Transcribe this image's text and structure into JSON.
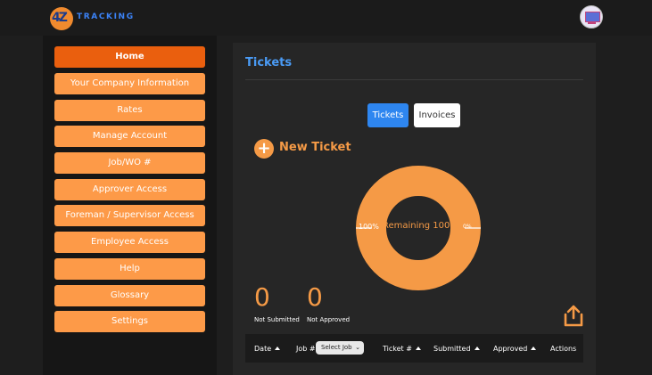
{
  "header": {
    "logo_mark": "4Z",
    "logo_text": "TRACKING"
  },
  "sidebar": {
    "items": [
      {
        "label": "Home",
        "active": true
      },
      {
        "label": "Your Company Information"
      },
      {
        "label": "Rates"
      },
      {
        "label": "Manage Account"
      },
      {
        "label": "Job/WO #"
      },
      {
        "label": "Approver Access"
      },
      {
        "label": "Foreman / Supervisor Access"
      },
      {
        "label": "Employee Access"
      },
      {
        "label": "Help"
      },
      {
        "label": "Glossary"
      },
      {
        "label": "Settings"
      }
    ]
  },
  "main": {
    "title": "Tickets",
    "tabs": [
      {
        "label": "Tickets",
        "active": true
      },
      {
        "label": "Invoices"
      }
    ],
    "new_ticket_label": "New Ticket",
    "donut": {
      "left_pct": "100%",
      "right_pct": "0%",
      "center_text": "Remaining 100%",
      "remaining_fraction": 1.0,
      "color": "#f59a46"
    },
    "stats": [
      {
        "value": "0",
        "label": "Not Submitted"
      },
      {
        "value": "0",
        "label": "Not Approved"
      }
    ],
    "share_icon": "share-upload-icon",
    "table": {
      "columns": [
        "Date",
        "Job #",
        "Ticket #",
        "Submitted",
        "Approved",
        "Actions"
      ],
      "job_select": "Select Job"
    }
  },
  "colors": {
    "accent_orange": "#fd9a48",
    "active_orange": "#ea5f0e",
    "title_blue": "#4a9bf5",
    "tab_blue": "#2e86f0"
  }
}
